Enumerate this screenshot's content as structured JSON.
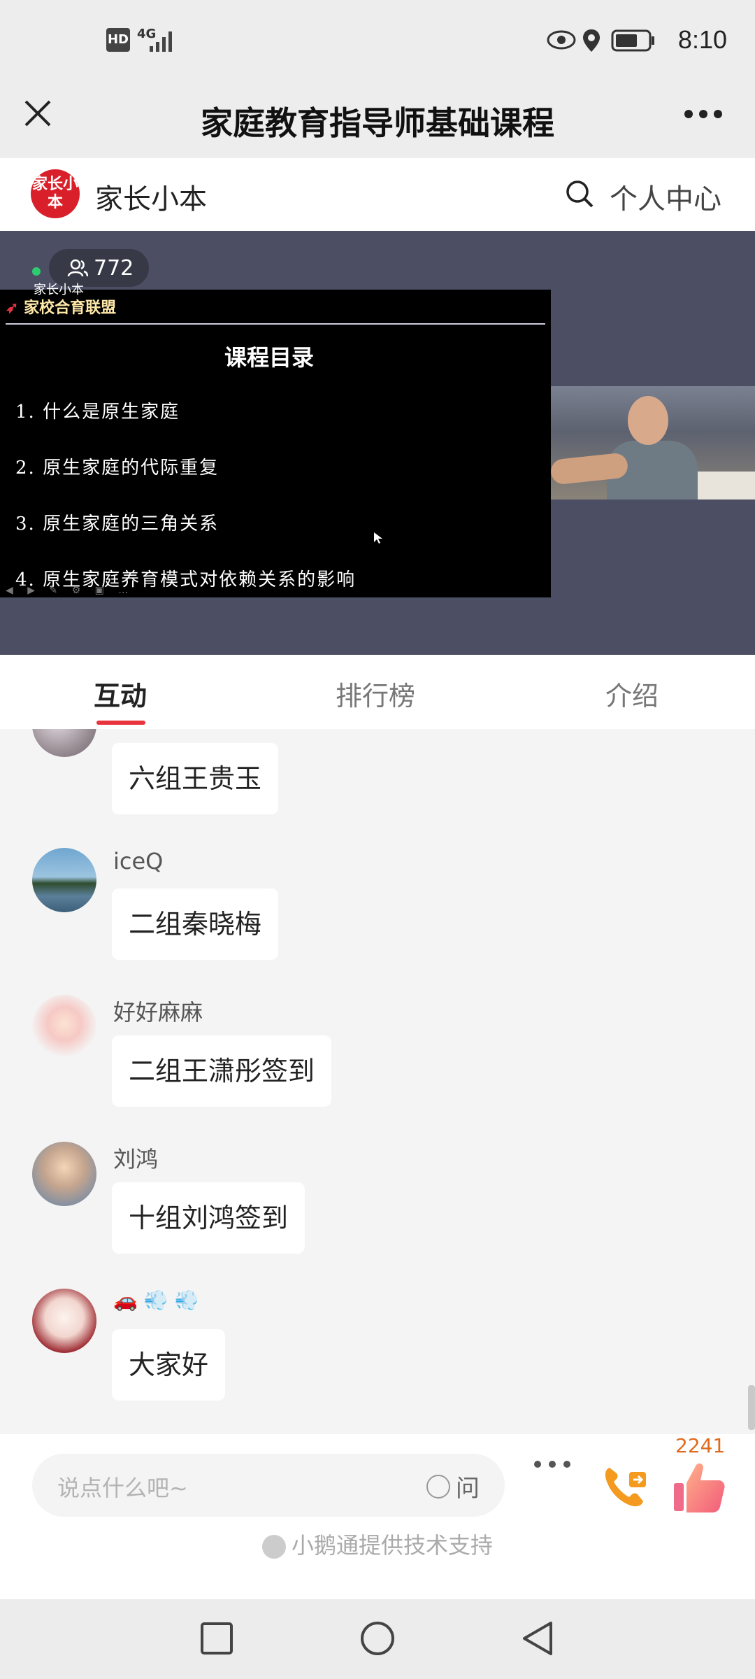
{
  "status": {
    "left_icons": "HD",
    "network": "4G",
    "time": "8:10"
  },
  "header": {
    "title": "家庭教育指导师基础课程"
  },
  "brand": {
    "logo_text": "家长小本",
    "name": "家长小本",
    "personal_center": "个人中心"
  },
  "live": {
    "viewers": "772",
    "slide": {
      "logo_top": "家长小本",
      "logo": "家校合育联盟",
      "title": "课程目录",
      "items": [
        "1. 什么是原生家庭",
        "2. 原生家庭的代际重复",
        "3. 原生家庭的三角关系",
        "4. 原生家庭养育模式对依赖关系的影响"
      ]
    }
  },
  "tabs": {
    "interactive": "互动",
    "ranking": "排行榜",
    "intro": "介绍"
  },
  "messages": [
    {
      "nick": "",
      "text": "六组王贵玉"
    },
    {
      "nick": "iceQ",
      "text": "二组秦晓梅"
    },
    {
      "nick": "好好麻麻",
      "text": "二组王潇彤签到"
    },
    {
      "nick": "刘鸿",
      "text": "十组刘鸿签到"
    },
    {
      "nick": "🚗 💨 💨",
      "text": "大家好"
    }
  ],
  "input": {
    "placeholder": "说点什么吧~",
    "ask": "问",
    "like_count": "2241"
  },
  "support": "小鹅通提供技术支持",
  "colors": {
    "accent": "#e8343e",
    "brand_red": "#d9202a",
    "like_orange": "#e06a1c",
    "live_bg": "#4c4f63"
  }
}
